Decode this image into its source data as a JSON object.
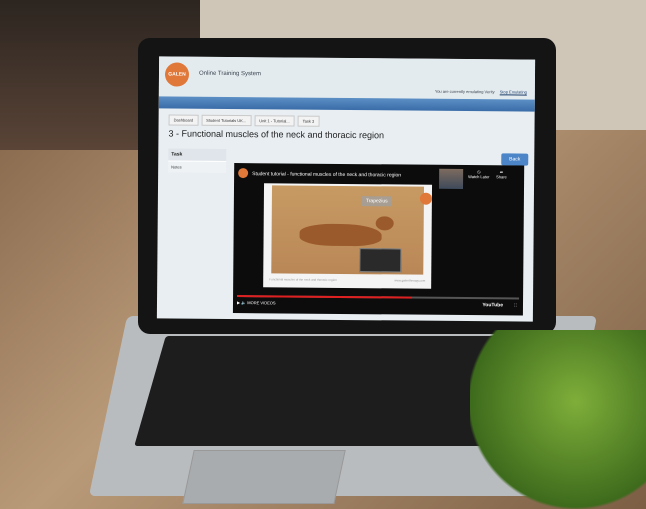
{
  "app": {
    "logo_text": "GALEN",
    "title": "Online Training System",
    "emulating_text": "You are currently emulating Verity",
    "stop_link": "Stop Emulating"
  },
  "breadcrumb": [
    "Dashboard",
    "Student Tutorials UK...",
    "Unit 1 - Tutorial...",
    "Task 3"
  ],
  "page_title": "3 - Functional muscles of the neck and thoracic region",
  "back_button": "Back",
  "sidebar": {
    "heading": "Task",
    "items": [
      "Notes"
    ]
  },
  "video": {
    "title": "Student tutorial - functional muscles of the neck and thoracic region",
    "watch_later": "Watch Later",
    "share": "Share",
    "overlay_label": "Trapezius",
    "caption": "Functional muscles of the neck and thoracic region",
    "site": "www.galentherapy.com",
    "more_videos": "MORE VIDEOS",
    "youtube": "YouTube",
    "progress": 0.62
  }
}
